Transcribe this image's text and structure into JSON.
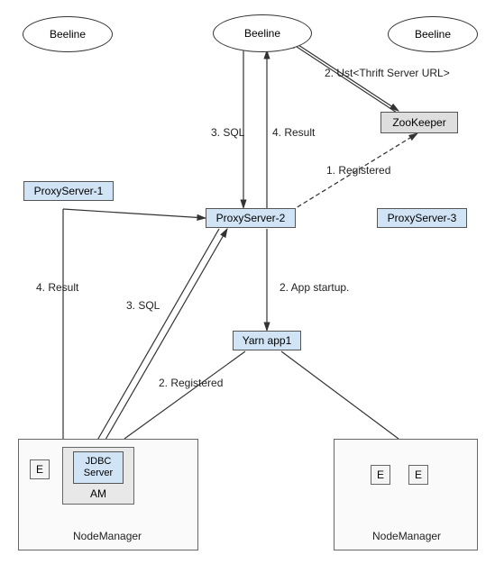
{
  "nodes": {
    "beeline1": "Beeline",
    "beeline2": "Beeline",
    "beeline3": "Beeline",
    "zookeeper": "ZooKeeper",
    "proxy1": "ProxyServer-1",
    "proxy2": "ProxyServer-2",
    "proxy3": "ProxyServer-3",
    "yarn": "Yarn app1",
    "jdbc": "JDBC\nServer",
    "am": "AM",
    "nm1": "NodeManager",
    "nm2": "NodeManager",
    "e": "E"
  },
  "edges": {
    "l1": "1. Registered",
    "l2a": "2. Ust<Thrift Server URL>",
    "l2b": "2. App startup.",
    "l2c": "2. Registered",
    "l3a": "3. SQL",
    "l3b": "3. SQL",
    "l4a": "4. Result",
    "l4b": "4. Result"
  }
}
